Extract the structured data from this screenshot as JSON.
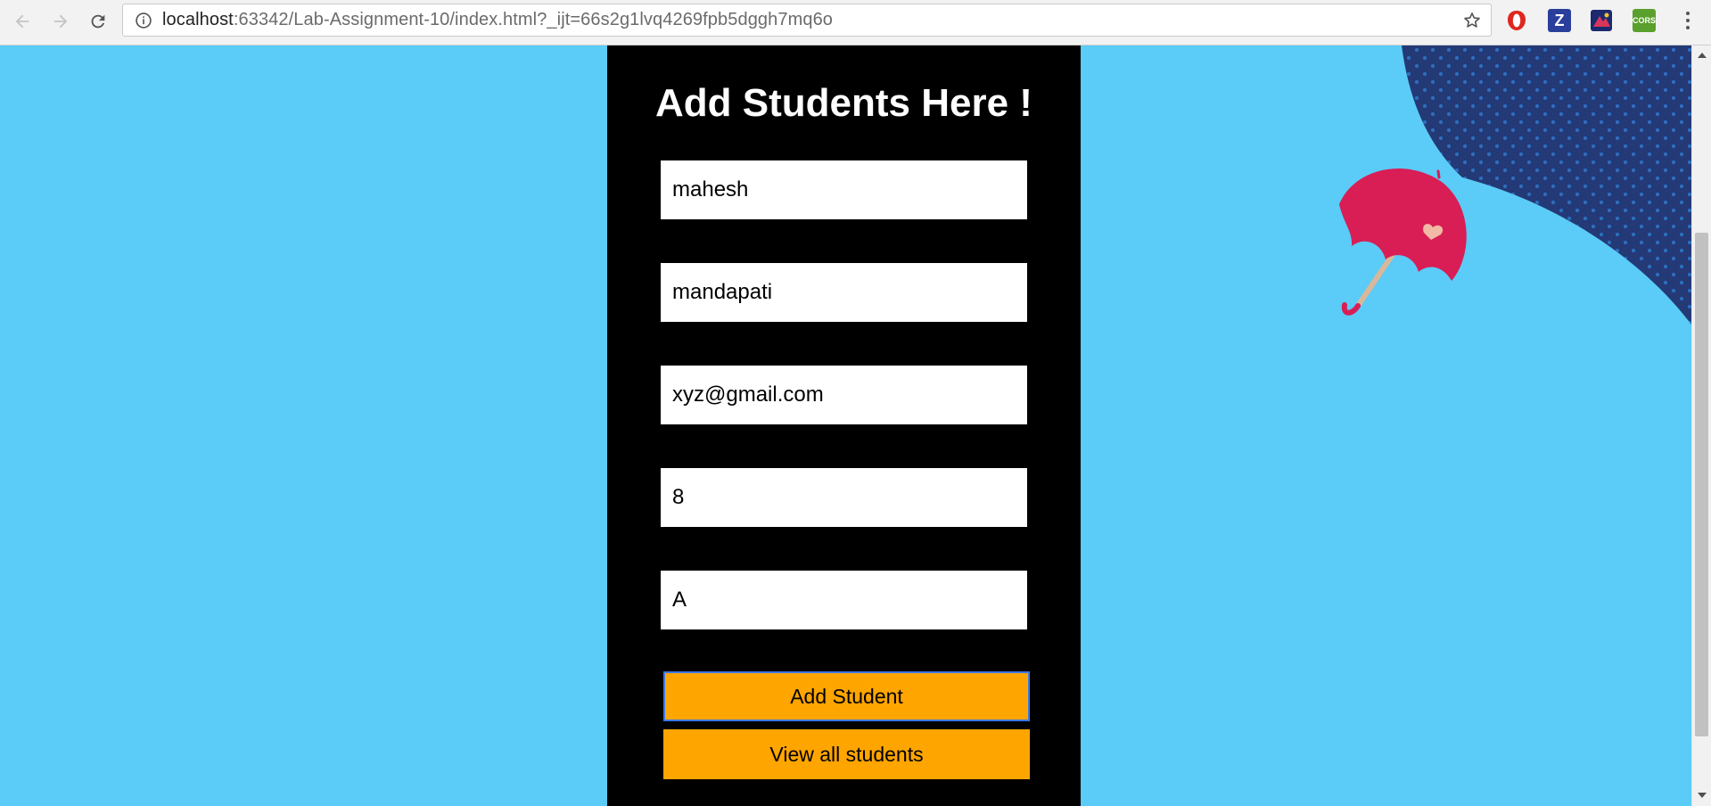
{
  "browser": {
    "url_host": "localhost",
    "url_path": ":63342/Lab-Assignment-10/index.html?_ijt=66s2g1lvq4269fpb5dggh7mq6o",
    "icons": {
      "back": "back-arrow-icon",
      "forward": "forward-arrow-icon",
      "reload": "reload-icon",
      "info": "info-icon",
      "bookmark": "star-icon"
    },
    "extensions": [
      {
        "name": "opera-extension-icon",
        "label": "",
        "color": "#e0261e"
      },
      {
        "name": "zotero-extension-icon",
        "label": "Z",
        "color": "#2a3f9b"
      },
      {
        "name": "mercury-extension-icon",
        "label": "",
        "color": "#1b2a6e"
      },
      {
        "name": "cors-extension-icon",
        "label": "CORS",
        "color": "#5aa02c"
      }
    ]
  },
  "page": {
    "background_color": "#5bcbf7",
    "panel_color": "#000000",
    "title": "Add Students Here !",
    "form": {
      "first_name": "mahesh",
      "last_name": "mandapati",
      "email": "xyz@gmail.com",
      "class": "8",
      "grade": "A"
    },
    "buttons": {
      "add": "Add Student",
      "view": "View all students"
    },
    "button_color": "#ffa500",
    "decoration": {
      "icon": "umbrella-icon",
      "umbrella_color": "#d81e55",
      "cloud_color": "#233a76"
    }
  }
}
